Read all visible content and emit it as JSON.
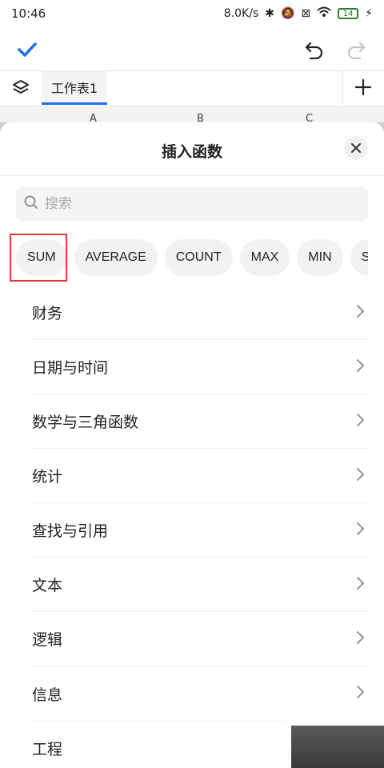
{
  "status": {
    "time": "10:46",
    "network_speed": "8.0K/s",
    "battery_level": "14"
  },
  "toolbar": {
    "confirm_icon": "check-icon",
    "undo_icon": "undo-icon",
    "redo_icon": "redo-icon",
    "accent_color": "#1a73e8"
  },
  "sheet_tabs": {
    "active_tab": "工作表1",
    "add_icon": "plus-icon"
  },
  "columns": [
    "A",
    "B",
    "C"
  ],
  "dialog": {
    "title": "插入函数",
    "search_placeholder": "搜索",
    "quick_functions": [
      "SUM",
      "AVERAGE",
      "COUNT",
      "MAX",
      "MIN",
      "STDEV"
    ],
    "categories": [
      "财务",
      "日期与时间",
      "数学与三角函数",
      "统计",
      "查找与引用",
      "文本",
      "逻辑",
      "信息",
      "工程"
    ]
  }
}
